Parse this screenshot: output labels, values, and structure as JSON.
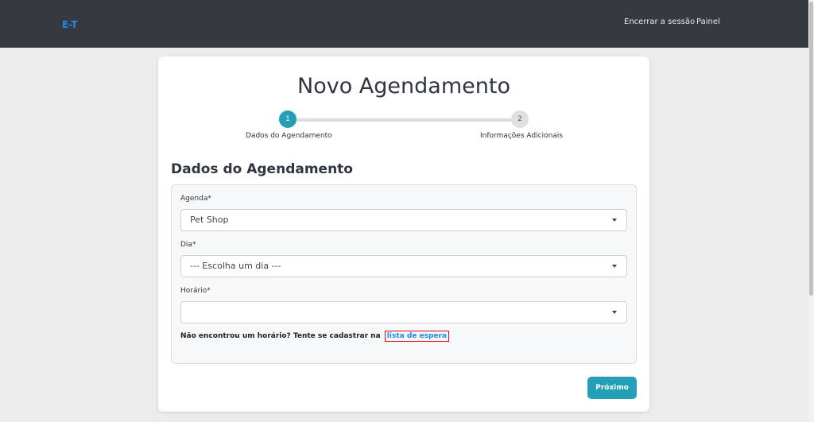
{
  "header": {
    "brand": "E-T",
    "logout": "Encerrar a sessão",
    "panel": "Painel"
  },
  "page": {
    "title": "Novo Agendamento"
  },
  "stepper": {
    "steps": [
      {
        "number": "1",
        "label": "Dados do Agendamento",
        "active": true
      },
      {
        "number": "2",
        "label": "Informações Adicionais",
        "active": false
      }
    ]
  },
  "form": {
    "section_title": "Dados do Agendamento",
    "agenda": {
      "label": "Agenda*",
      "value": "Pet Shop"
    },
    "dia": {
      "label": "Dia*",
      "value": "--- Escolha um dia ---"
    },
    "horario": {
      "label": "Horário*",
      "value": ""
    },
    "waitlist_text": "Não encontrou um horário? Tente se cadastrar na",
    "waitlist_link": "lista de espera"
  },
  "actions": {
    "next": "Próximo"
  },
  "colors": {
    "navbar": "#343a40",
    "brand": "#1d8cf0",
    "accent": "#23a0b8",
    "highlight_border": "#e2001a"
  }
}
